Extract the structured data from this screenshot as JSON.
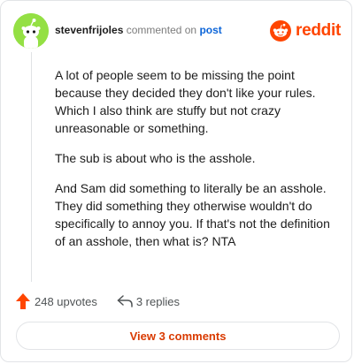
{
  "header": {
    "username": "stevenfrijoles",
    "action_text": "commented on",
    "post_link": "post"
  },
  "brand": {
    "name": "reddit",
    "icon": "reddit-logo-icon",
    "color": "#ff4500"
  },
  "avatar": {
    "icon": "snoo-avatar-icon",
    "background_color": "#94e044"
  },
  "comment": {
    "paragraphs": [
      "A lot of people seem to be missing the point because they decided they don't like your rules. Which I also think are stuffy but not crazy unreasonable or something.",
      "The sub is about who is the asshole.",
      "And Sam did something to literally be an asshole. They did something they otherwise wouldn't do specifically to annoy you. If that's not the definition of an asshole, then what is? NTA"
    ]
  },
  "actions": {
    "upvotes_label": "248 upvotes",
    "upvote_icon": "upvote-arrow-icon",
    "upvote_color": "#ff4500",
    "replies_label": "3 replies",
    "reply_icon": "reply-arrow-icon"
  },
  "footer": {
    "view_comments_label": "View 3 comments",
    "accent_color": "#d93a00"
  }
}
